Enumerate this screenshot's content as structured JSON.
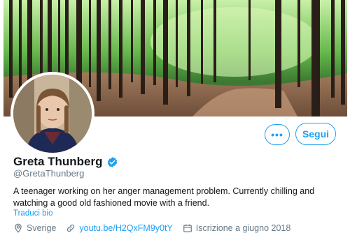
{
  "profile": {
    "name": "Greta Thunberg",
    "handle": "@GretaThunberg",
    "bio": "A teenager working on her anger management problem. Currently chilling and watching a good old fashioned movie with a friend.",
    "translate_label": "Traduci bio",
    "location": "Sverige",
    "website": "youtu.be/H2QxFM9y0tY",
    "joined": "Iscrizione a giugno 2018"
  },
  "actions": {
    "more_label": "•••",
    "follow_label": "Segui"
  },
  "icons": {
    "verified": "verified-badge-icon",
    "location": "location-pin-icon",
    "website": "link-icon",
    "joined": "calendar-icon"
  },
  "colors": {
    "accent": "#1da1f2",
    "secondary_text": "#657786",
    "primary_text": "#14171a"
  }
}
